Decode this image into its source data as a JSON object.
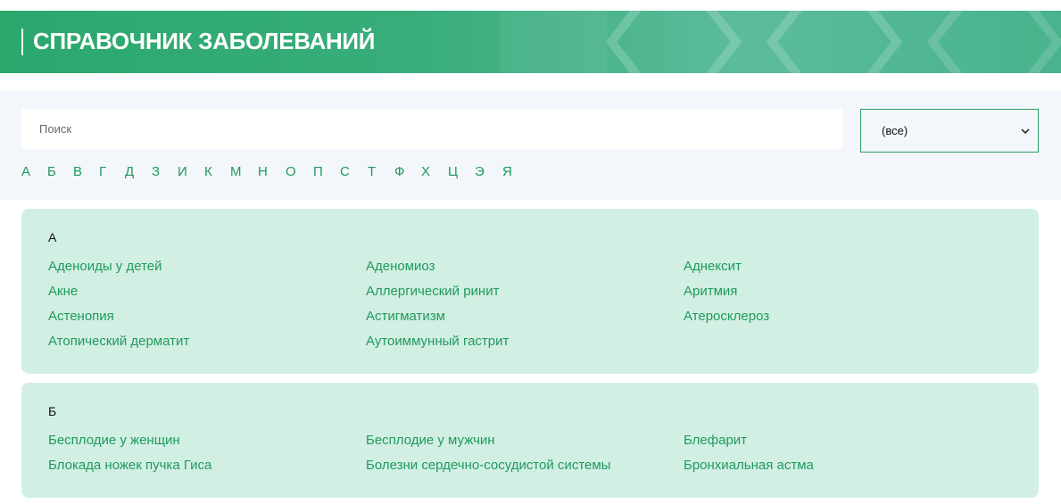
{
  "header": {
    "title": "СПРАВОЧНИК ЗАБОЛЕВАНИЙ"
  },
  "search": {
    "placeholder": "Поиск",
    "value": ""
  },
  "category_select": {
    "selected": "(все)"
  },
  "alphabet": [
    "А",
    "Б",
    "В",
    "Г",
    "Д",
    "З",
    "И",
    "К",
    "М",
    "Н",
    "О",
    "П",
    "С",
    "Т",
    "Ф",
    "Х",
    "Ц",
    "Э",
    "Я"
  ],
  "sections": [
    {
      "letter": "А",
      "items": [
        "Аденоиды у детей",
        "Аденомиоз",
        "Аднексит",
        "Акне",
        "Аллергический ринит",
        "Аритмия",
        "Астенопия",
        "Астигматизм",
        "Атеросклероз",
        "Атопический дерматит",
        "Аутоиммунный гастрит"
      ]
    },
    {
      "letter": "Б",
      "items": [
        "Бесплодие у женщин",
        "Бесплодие у мужчин",
        "Блефарит",
        "Блокада ножек пучка Гиса",
        "Болезни сердечно-сосудистой системы",
        "Бронхиальная астма"
      ]
    }
  ],
  "colors": {
    "accent": "#1f9a5e",
    "card_bg": "#d2efe3",
    "filter_bg": "#f3f6fa"
  }
}
